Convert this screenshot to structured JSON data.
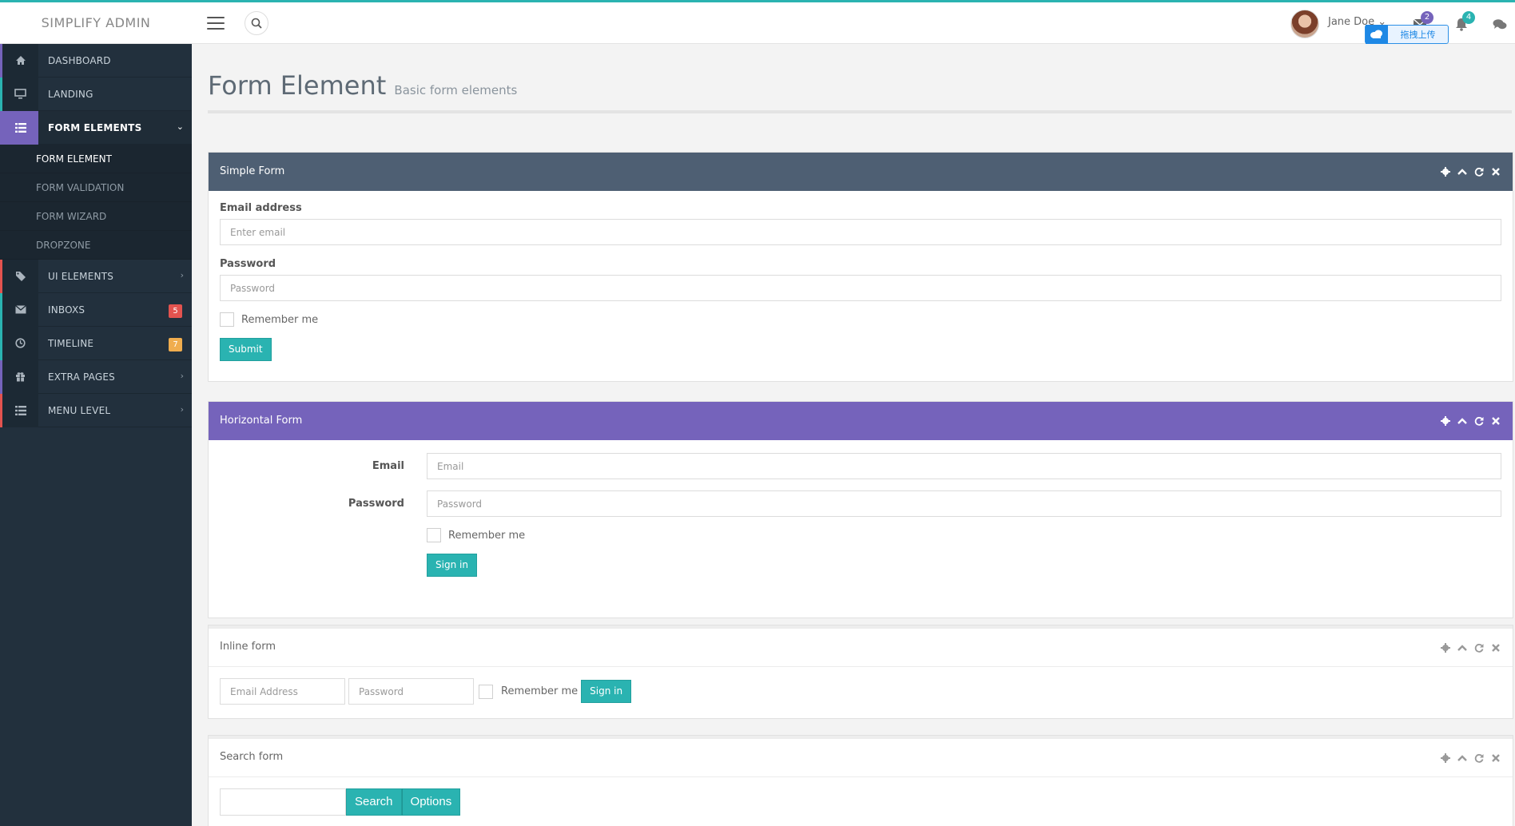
{
  "brand": "SIMPLIFY ADMIN",
  "user": {
    "name": "Jane Doe",
    "caret": "⌄"
  },
  "notifications": {
    "mail_count": "2",
    "bell_count": "4"
  },
  "upload_widget": {
    "label": "拖拽上传"
  },
  "sidebar": {
    "items": [
      {
        "label": "DASHBOARD",
        "icon": "home-icon",
        "accent": "#7563bb"
      },
      {
        "label": "LANDING",
        "icon": "monitor-icon",
        "accent": "#2ab3b1"
      },
      {
        "label": "FORM ELEMENTS",
        "icon": "list-icon",
        "accent": "#7563bb",
        "arrow": "⌄"
      },
      {
        "label": "UI ELEMENTS",
        "icon": "tags-icon",
        "accent": "#e3534f",
        "arrow": "›"
      },
      {
        "label": "INBOXS",
        "icon": "envelope-icon",
        "accent": "#2ab3b1",
        "badge": "5",
        "badge_color": "#e3534f"
      },
      {
        "label": "TIMELINE",
        "icon": "clock-icon",
        "accent": "#2ab3b1",
        "badge": "7",
        "badge_color": "#f0ad4e"
      },
      {
        "label": "EXTRA PAGES",
        "icon": "gift-icon",
        "accent": "#7563bb",
        "arrow": "›"
      },
      {
        "label": "MENU LEVEL",
        "icon": "list-icon",
        "accent": "#e3534f",
        "arrow": "›"
      }
    ],
    "sub_items": [
      "FORM ELEMENT",
      "FORM VALIDATION",
      "FORM WIZARD",
      "DROPZONE"
    ]
  },
  "page": {
    "title": "Form Element",
    "subtitle": "Basic form elements"
  },
  "simple_form": {
    "heading": "Simple Form",
    "email_label": "Email address",
    "email_placeholder": "Enter email",
    "password_label": "Password",
    "password_placeholder": "Password",
    "remember": "Remember me",
    "submit": "Submit"
  },
  "horizontal_form": {
    "heading": "Horizontal Form",
    "email_label": "Email",
    "email_placeholder": "Email",
    "password_label": "Password",
    "password_placeholder": "Password",
    "remember": "Remember me",
    "signin": "Sign in"
  },
  "inline_form": {
    "heading": "Inline form",
    "email_placeholder": "Email Address",
    "password_placeholder": "Password",
    "remember": "Remember me",
    "signin": "Sign in"
  },
  "search_form": {
    "heading": "Search form",
    "search_value": "",
    "search_button": "Search",
    "options_button": "Options"
  }
}
